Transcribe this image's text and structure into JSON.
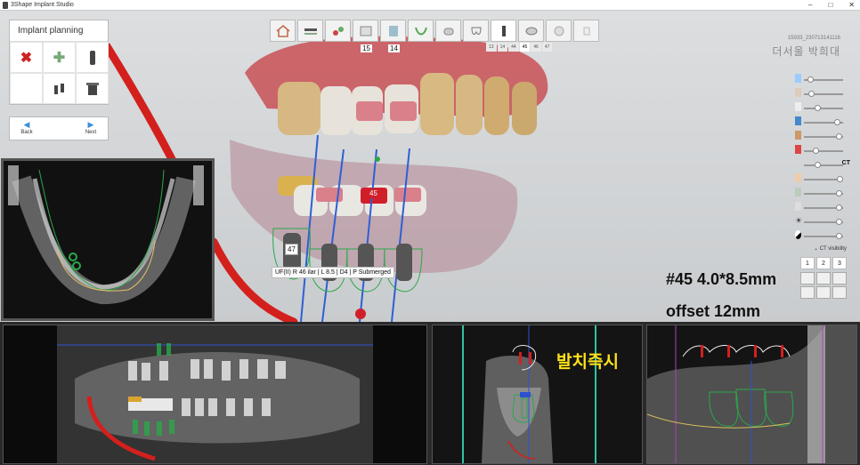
{
  "window": {
    "title": "3Shape Implant Studio",
    "minimize": "–",
    "maximize": "□",
    "close": "✕"
  },
  "toolbar": {
    "tooth_numbers": [
      "15",
      "14"
    ],
    "tooth_strip": [
      "13",
      "14",
      "44",
      "45",
      "46",
      "47"
    ],
    "active_tooth": "45"
  },
  "patient": {
    "id": "15933_230713141116",
    "name": "더서울 박희대"
  },
  "side_panel": {
    "title": "Implant planning",
    "back_label": "Back",
    "next_label": "Next"
  },
  "right_panel": {
    "ct_label": "CT",
    "ct_visibility_label": "CT visibility",
    "view_numbers": [
      "1",
      "2",
      "3"
    ],
    "slider_levels": [
      0.1,
      0.12,
      0.3,
      0.85,
      0.9,
      0.25,
      0.3,
      0.92,
      0.9,
      0.9,
      0.9,
      0.9
    ]
  },
  "scene": {
    "selected_tooth_tag": "45",
    "implant_tag": "47",
    "implant_info": "UF(II) R 46 ilar | L 8.5 | D4 | P Submerged"
  },
  "annotations": {
    "spec": "#45 4.0*8.5mm",
    "offset": "offset 12mm",
    "korean_note": "발치즉시"
  },
  "colors": {
    "accent_blue": "#3a8ed8",
    "nerve_red": "#d3201d",
    "implant_green": "#2aa84a",
    "note_yellow": "#ffe21a"
  }
}
